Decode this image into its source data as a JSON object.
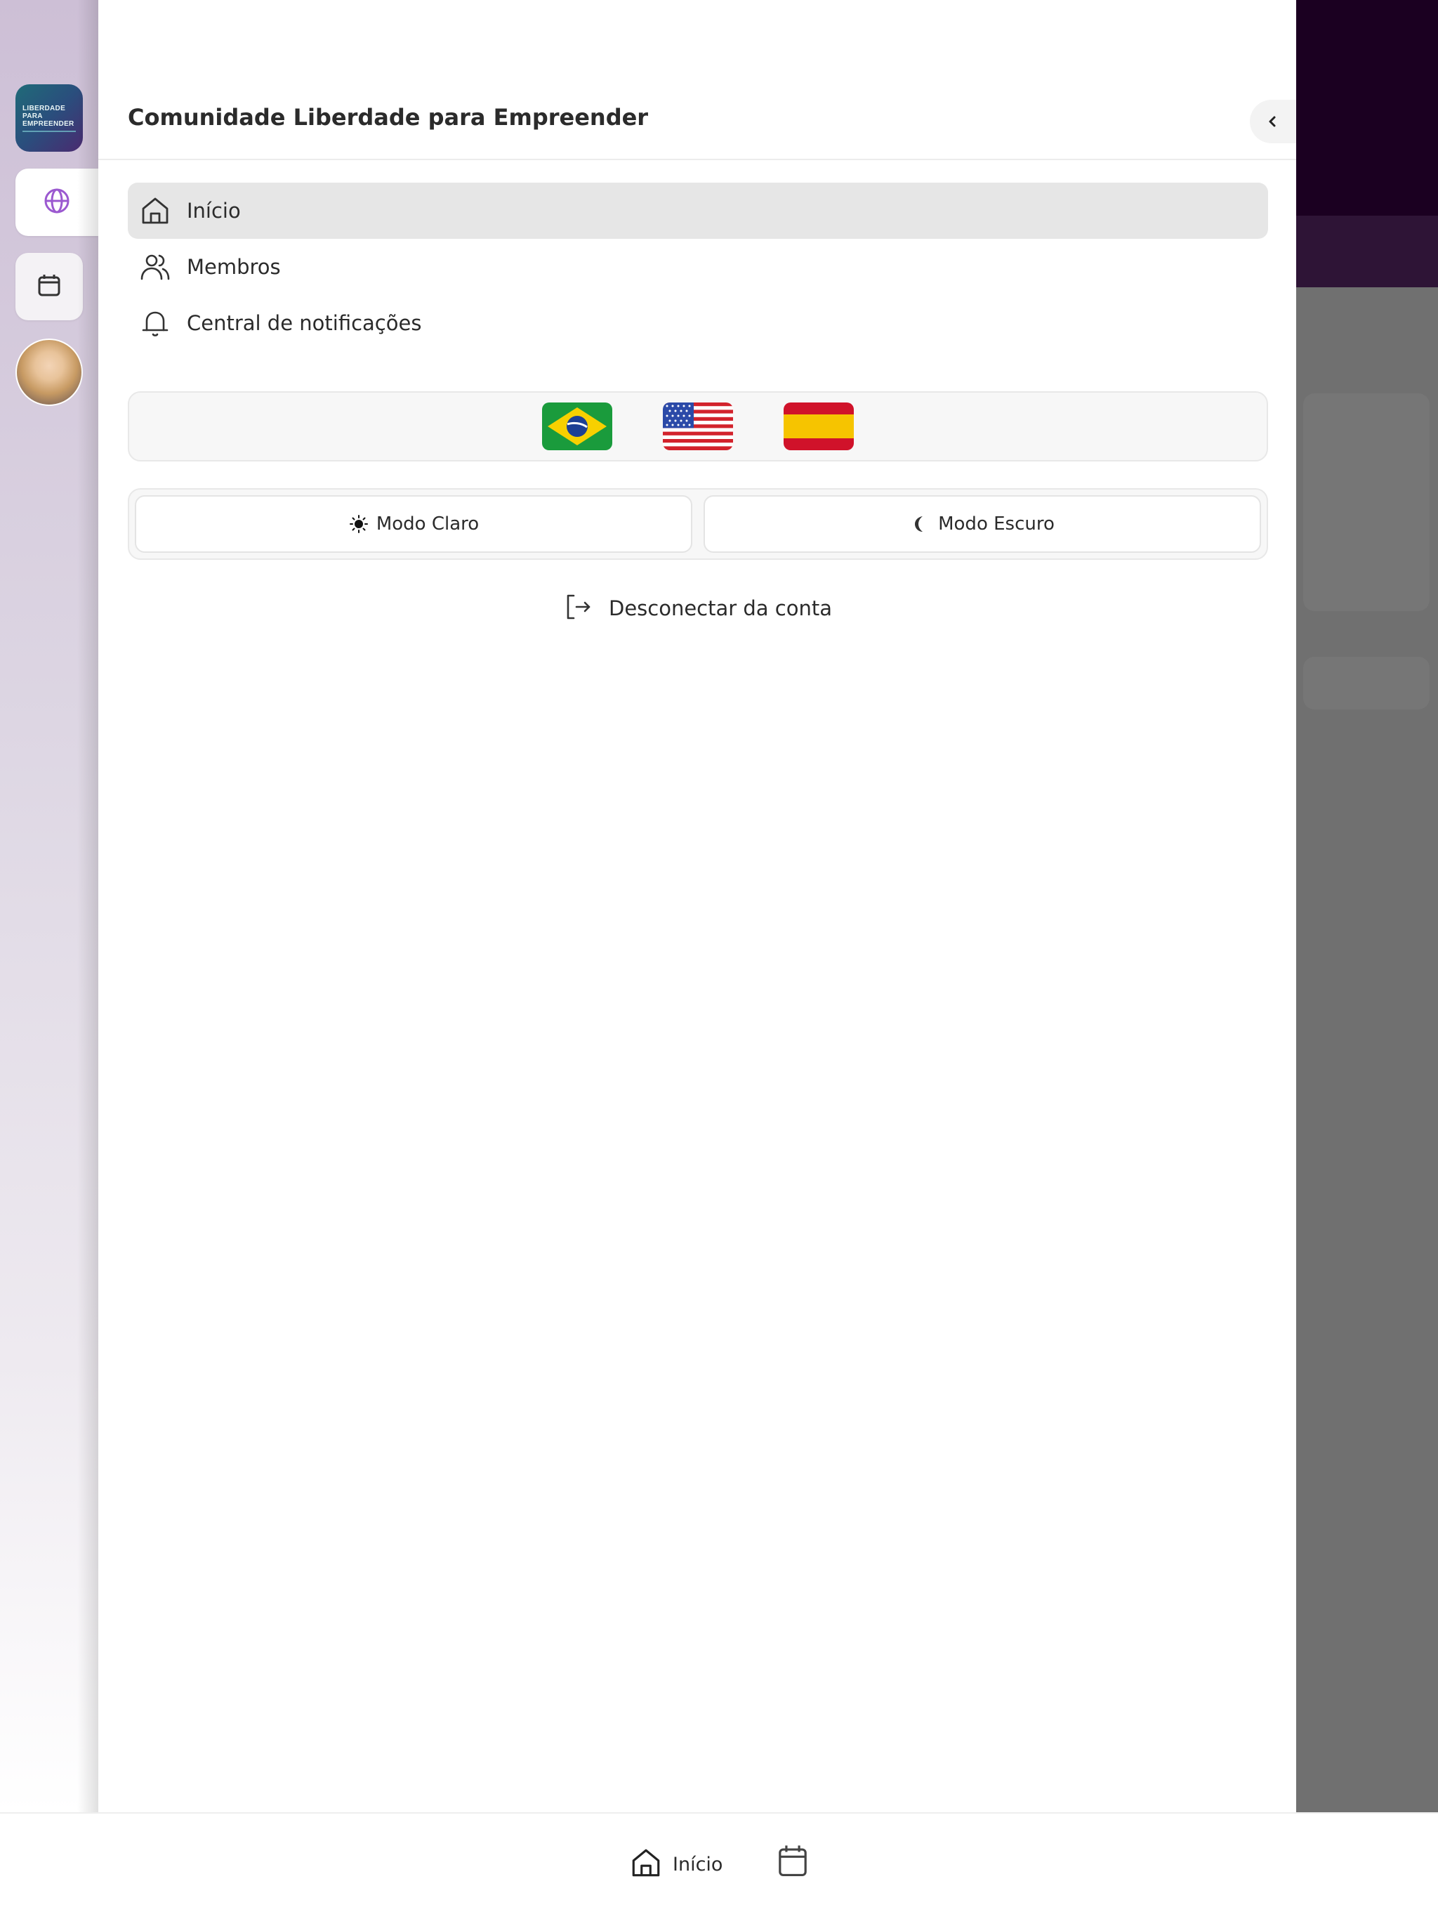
{
  "app": {
    "community_title": "Comunidade Liberdade para Empreender",
    "logo_lines": [
      "LIBERDADE",
      "PARA",
      "EMPREENDER"
    ]
  },
  "rail": {
    "items": [
      {
        "name": "community-logo"
      },
      {
        "name": "globe",
        "icon": "globe-icon",
        "active": true
      },
      {
        "name": "calendar",
        "icon": "calendar-icon"
      },
      {
        "name": "avatar"
      }
    ],
    "accent_color": "#9b59d0"
  },
  "drawer": {
    "collapse_icon": "chevron-left-icon",
    "nav": [
      {
        "label": "Início",
        "icon": "home-icon",
        "active": true
      },
      {
        "label": "Membros",
        "icon": "users-icon",
        "active": false
      },
      {
        "label": "Central de notificações",
        "icon": "bell-icon",
        "active": false
      }
    ],
    "languages": [
      {
        "name": "Português (Brasil)",
        "icon": "flag-brazil-icon"
      },
      {
        "name": "English (US)",
        "icon": "flag-usa-icon"
      },
      {
        "name": "Español",
        "icon": "flag-spain-icon"
      }
    ],
    "theme": {
      "light_label": "Modo Claro",
      "dark_label": "Modo Escuro"
    },
    "logout_label": "Desconectar da conta"
  },
  "bottom_bar": {
    "home_label": "Início",
    "calendar_icon": "calendar-icon"
  }
}
